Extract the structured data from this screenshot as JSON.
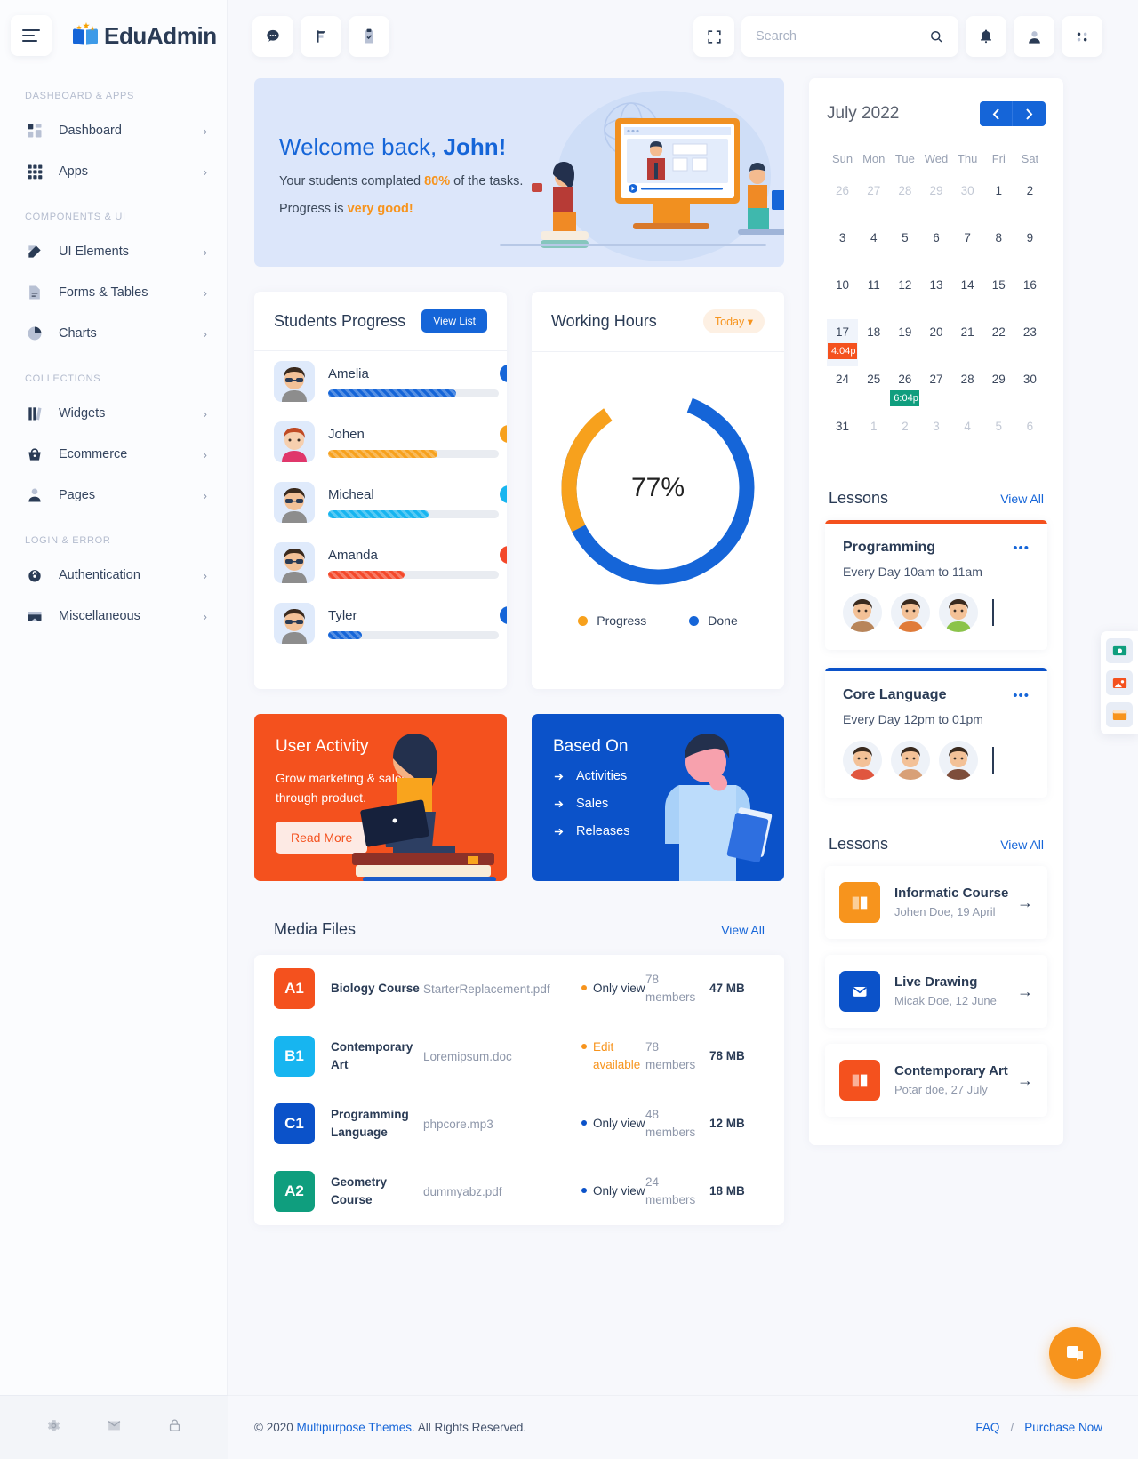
{
  "brand": {
    "name": "EduAdmin"
  },
  "sidebar": {
    "sections": [
      {
        "label": "DASHBOARD & APPS",
        "items": [
          {
            "label": "Dashboard",
            "icon": "grid-icon",
            "chevron": "›"
          },
          {
            "label": "Apps",
            "icon": "apps-icon",
            "chevron": "›"
          }
        ]
      },
      {
        "label": "COMPONENTS & UI",
        "items": [
          {
            "label": "UI Elements",
            "icon": "pencil-square-icon",
            "chevron": "›"
          },
          {
            "label": "Forms & Tables",
            "icon": "document-icon",
            "chevron": "›"
          },
          {
            "label": "Charts",
            "icon": "pie-chart-icon",
            "chevron": "›"
          }
        ]
      },
      {
        "label": "COLLECTIONS",
        "items": [
          {
            "label": "Widgets",
            "icon": "books-icon",
            "chevron": "›"
          },
          {
            "label": "Ecommerce",
            "icon": "basket-icon",
            "chevron": "›"
          },
          {
            "label": "Pages",
            "icon": "user-icon",
            "chevron": "›"
          }
        ]
      },
      {
        "label": "LOGIN & ERROR",
        "items": [
          {
            "label": "Authentication",
            "icon": "lock-icon",
            "chevron": "›"
          },
          {
            "label": "Miscellaneous",
            "icon": "card-icon",
            "chevron": "›"
          }
        ]
      }
    ],
    "bottom_icons": [
      "gear-icon",
      "mail-icon",
      "lock-icon"
    ]
  },
  "header": {
    "left_icons": [
      "chat-icon",
      "signpost-icon",
      "clipboard-check-icon"
    ],
    "fullscreen_icon": "fullscreen-icon",
    "search": {
      "placeholder": "Search",
      "value": "",
      "icon": "search-icon"
    },
    "right_icons": [
      "bell-icon",
      "user-icon",
      "settings-dots-icon"
    ]
  },
  "welcome": {
    "title_prefix": "Welcome back, ",
    "title_name": "John!",
    "line1_a": "Your students complated ",
    "line1_b": "80%",
    "line1_c": " of the tasks.",
    "line2_a": "Progress is ",
    "line2_b": "very good!"
  },
  "students": {
    "title": "Students Progress",
    "button": "View List",
    "rows": [
      {
        "name": "Amelia",
        "pct": 75,
        "label": "75%",
        "color": "#1565d8"
      },
      {
        "name": "Johen",
        "pct": 64,
        "label": "64%",
        "color": "#f7a11d"
      },
      {
        "name": "Micheal",
        "pct": 59,
        "label": "59%",
        "color": "#17b5f0"
      },
      {
        "name": "Amanda",
        "pct": 45,
        "label": "45%",
        "color": "#f4482a"
      },
      {
        "name": "Tyler",
        "pct": 20,
        "label": "20%",
        "color": "#1565d8"
      }
    ]
  },
  "working_hours": {
    "title": "Working Hours",
    "filter": "Today",
    "center_value": "77%",
    "legend": [
      {
        "label": "Progress",
        "color": "#f7a11d"
      },
      {
        "label": "Done",
        "color": "#1565d8"
      }
    ]
  },
  "chart_data": {
    "type": "pie",
    "title": "Working Hours",
    "labels": [
      "Done",
      "Progress"
    ],
    "values": [
      77,
      23
    ],
    "colors": [
      "#1565d8",
      "#f7a11d"
    ],
    "center_label": "77%",
    "legend_position": "bottom",
    "donut": true
  },
  "promo_orange": {
    "title": "User Activity",
    "text": "Grow marketing & sales through product.",
    "button": "Read More"
  },
  "promo_blue": {
    "title": "Based On",
    "items": [
      "Activities",
      "Sales",
      "Releases"
    ]
  },
  "media": {
    "title": "Media Files",
    "view_all": "View All",
    "rows": [
      {
        "tag": "A1",
        "tag_color": "#f4511e",
        "course": "Biology Course",
        "file": "StarterReplacement.pdf",
        "permission": "Only view",
        "perm_color": "#f7941d",
        "perm_text_color": "#2a3b55",
        "members": "78 members",
        "size": "47 MB"
      },
      {
        "tag": "B1",
        "tag_color": "#17b5f0",
        "course": "Contemporary Art",
        "file": "Loremipsum.doc",
        "permission": "Edit available",
        "perm_color": "#f7941d",
        "perm_text_color": "#f7941d",
        "members": "78 members",
        "size": "78 MB"
      },
      {
        "tag": "C1",
        "tag_color": "#0b52c9",
        "course": "Programming Language",
        "file": "phpcore.mp3",
        "permission": "Only view",
        "perm_color": "#0b52c9",
        "perm_text_color": "#2a3b55",
        "members": "48 members",
        "size": "12 MB"
      },
      {
        "tag": "A2",
        "tag_color": "#0f9e7e",
        "course": "Geometry Course",
        "file": "dummyabz.pdf",
        "permission": "Only view",
        "perm_color": "#0b52c9",
        "perm_text_color": "#2a3b55",
        "members": "24 members",
        "size": "18 MB"
      }
    ]
  },
  "calendar": {
    "month": "July 2022",
    "prev_icon": "chevron-left-icon",
    "next_icon": "chevron-right-icon",
    "dow": [
      "Sun",
      "Mon",
      "Tue",
      "Wed",
      "Thu",
      "Fri",
      "Sat"
    ],
    "weeks": [
      [
        {
          "d": "26",
          "muted": true
        },
        {
          "d": "27",
          "muted": true
        },
        {
          "d": "28",
          "muted": true
        },
        {
          "d": "29",
          "muted": true
        },
        {
          "d": "30",
          "muted": true
        },
        {
          "d": "1"
        },
        {
          "d": "2"
        }
      ],
      [
        {
          "d": "3"
        },
        {
          "d": "4"
        },
        {
          "d": "5"
        },
        {
          "d": "6"
        },
        {
          "d": "7"
        },
        {
          "d": "8"
        },
        {
          "d": "9"
        }
      ],
      [
        {
          "d": "10"
        },
        {
          "d": "11"
        },
        {
          "d": "12"
        },
        {
          "d": "13"
        },
        {
          "d": "14"
        },
        {
          "d": "15"
        },
        {
          "d": "16"
        }
      ],
      [
        {
          "d": "17",
          "selected": true,
          "event": "4:04p",
          "event_color": "#f4511e"
        },
        {
          "d": "18"
        },
        {
          "d": "19"
        },
        {
          "d": "20"
        },
        {
          "d": "21"
        },
        {
          "d": "22"
        },
        {
          "d": "23"
        }
      ],
      [
        {
          "d": "24"
        },
        {
          "d": "25"
        },
        {
          "d": "26",
          "event": "6:04p",
          "event_color": "#0f9e7e"
        },
        {
          "d": "27"
        },
        {
          "d": "28"
        },
        {
          "d": "29"
        },
        {
          "d": "30"
        }
      ],
      [
        {
          "d": "31"
        },
        {
          "d": "1",
          "muted": true
        },
        {
          "d": "2",
          "muted": true
        },
        {
          "d": "3",
          "muted": true
        },
        {
          "d": "4",
          "muted": true
        },
        {
          "d": "5",
          "muted": true
        },
        {
          "d": "6",
          "muted": true
        }
      ]
    ]
  },
  "lessons_cards": {
    "title": "Lessons",
    "view_all": "View All",
    "items": [
      {
        "name": "Programming",
        "when": "Every Day 10am to 11am",
        "accent": "#f4511e",
        "dots": "•••",
        "faces": [
          "#b8855a",
          "#e07b39",
          "#8bc34a"
        ]
      },
      {
        "name": "Core Language",
        "when": "Every Day 12pm to 01pm",
        "accent": "#0b52c9",
        "dots": "•••",
        "faces": [
          "#e0563f",
          "#d8a077",
          "#7e4e3b"
        ]
      }
    ]
  },
  "lessons_list": {
    "title": "Lessons",
    "view_all": "View All",
    "items": [
      {
        "title": "Informatic Course",
        "sub": "Johen Doe, 19 April",
        "icon": "book-icon",
        "icon_bg": "#f7941d",
        "arrow": "→"
      },
      {
        "title": "Live Drawing",
        "sub": "Micak Doe, 12 June",
        "icon": "mail-icon",
        "icon_bg": "#0b52c9",
        "arrow": "→"
      },
      {
        "title": "Contemporary Art",
        "sub": "Potar doe, 27 July",
        "icon": "book-icon",
        "icon_bg": "#f4511e",
        "arrow": "→"
      }
    ]
  },
  "float_bar": {
    "buttons": [
      "money-icon",
      "image-icon",
      "browser-icon"
    ]
  },
  "fab": {
    "icon": "chat-bubble-icon"
  },
  "footer": {
    "copyright_a": "© 2020 ",
    "copyright_link": "Multipurpose Themes",
    "copyright_b": ". All Rights Reserved.",
    "faq": "FAQ",
    "sep": "/",
    "purchase": "Purchase Now"
  }
}
